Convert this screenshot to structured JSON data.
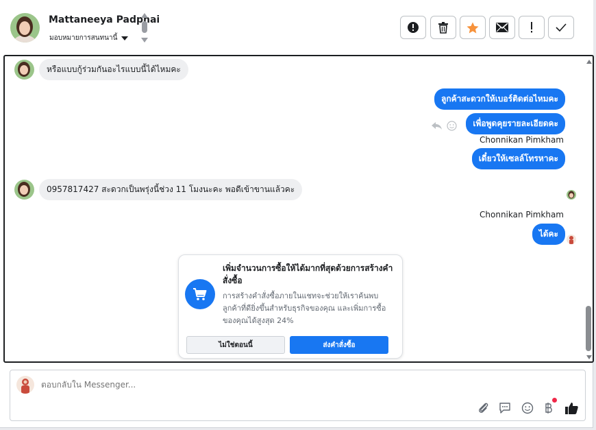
{
  "header": {
    "contact_name": "Mattaneeya Padphai",
    "assign_label": "มอบหมายการสนทนานี้",
    "toolbar": [
      {
        "name": "spam-button",
        "icon": "alert-circle-icon"
      },
      {
        "name": "delete-button",
        "icon": "trash-icon"
      },
      {
        "name": "star-button",
        "icon": "star-icon",
        "color": "#f7923b"
      },
      {
        "name": "mark-unread-button",
        "icon": "envelope-icon"
      },
      {
        "name": "follow-up-button",
        "icon": "exclamation-icon"
      },
      {
        "name": "mark-done-button",
        "icon": "check-icon"
      }
    ]
  },
  "messages": [
    {
      "direction": "in",
      "text": "หรือแบบกู้ร่วมกันอะไรแบบนี้ได้ไหมคะ"
    },
    {
      "direction": "out",
      "text": "ลูกค้าสะดวกให้เบอร์ติดต่อไหมคะ"
    },
    {
      "direction": "out",
      "text": "เพื่อพูดคุยรายละเอียดคะ"
    },
    {
      "direction": "out",
      "sender": "Chonnikan Pimkham",
      "text": "เดี๋ยวให้เซลล์โทรหาคะ"
    },
    {
      "direction": "in",
      "text": "0957817427 สะดวกเป็นพรุ่งนี้ช่วง 11 โมงนะคะ พอดีเข้าขานแล้วคะ"
    },
    {
      "direction": "out",
      "sender": "Chonnikan Pimkham",
      "text": "ได้คะ"
    }
  ],
  "promo": {
    "title": "เพิ่มจำนวนการซื้อให้ได้มากที่สุดด้วยการสร้างคำสั่งซื้อ",
    "body": "การสร้างคำสั่งซื้อภายในแชทจะช่วยให้เราค้นพบลูกค้าที่ดียิ่งขึ้นสำหรับธุรกิจของคุณ และเพิ่มการซื้อของคุณได้สูงสุด 24%",
    "secondary_button": "ไม่ใช่ตอนนี้",
    "primary_button": "ส่งคำสั่งซื้อ"
  },
  "composer": {
    "placeholder": "ตอบกลับใน Messenger...",
    "icons": [
      "attachment-icon",
      "saved-reply-icon",
      "emoji-icon",
      "baht-payment-icon",
      "thumbs-up-icon"
    ]
  },
  "colors": {
    "accent": "#1877f2",
    "star": "#f7923b",
    "notification_dot": "#f02849"
  }
}
